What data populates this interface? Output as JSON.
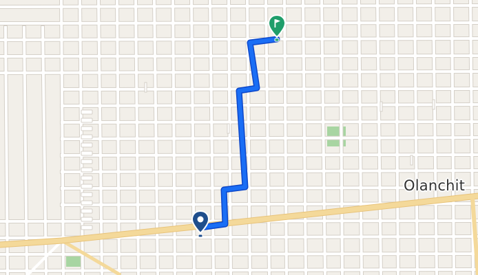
{
  "map": {
    "place_label": "Olanchit",
    "colors": {
      "background": "#f2efe9",
      "street": "#ffffff",
      "street_outline": "#d4cfc7",
      "highway": "#f4d99a",
      "park": "#a8d5a2",
      "route": "#1a6ef5",
      "route_outline": "#0d47c9",
      "start_marker": "#1f4e8c",
      "destination_marker": "#1f9e6a"
    },
    "icons": {
      "start": "location-pin-icon",
      "destination": "flag-pin-icon"
    }
  }
}
